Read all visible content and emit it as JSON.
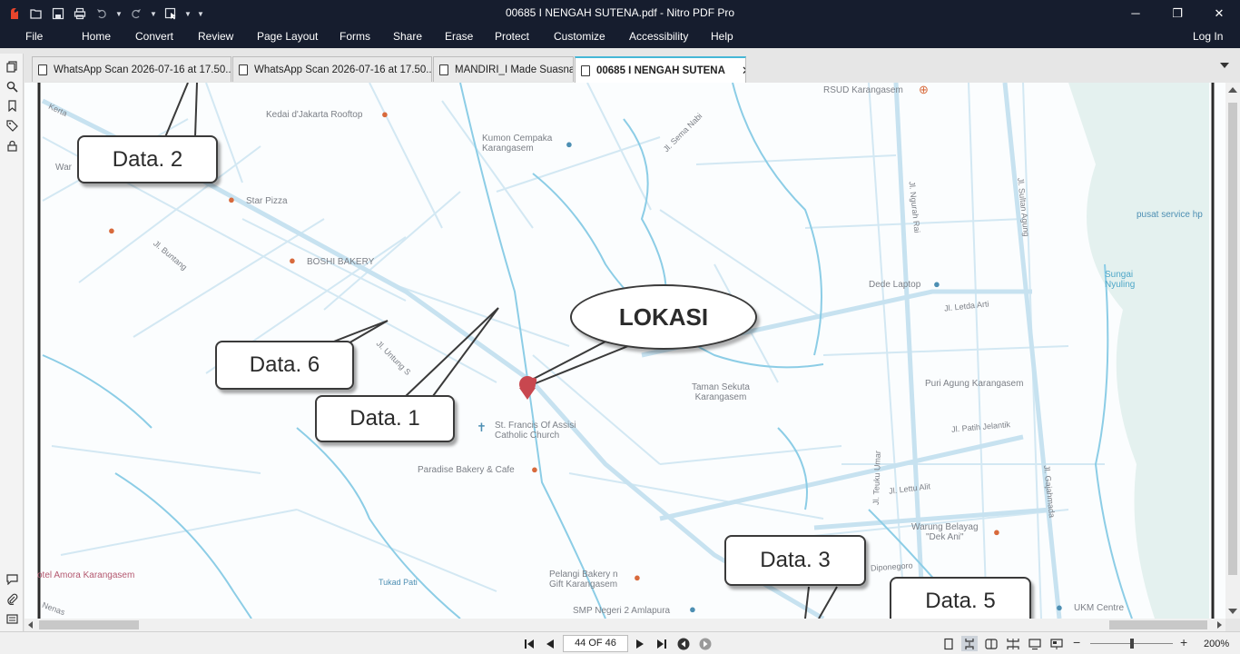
{
  "window": {
    "title": "00685 I NENGAH SUTENA.pdf - Nitro PDF Pro",
    "minimize": "─",
    "restore": "❐",
    "close": "✕"
  },
  "menu": [
    "File",
    "Home",
    "Convert",
    "Review",
    "Page Layout",
    "Forms",
    "Share",
    "Erase",
    "Protect",
    "Customize",
    "Accessibility",
    "Help"
  ],
  "login": "Log In",
  "tabs": [
    {
      "label": "WhatsApp Scan 2026-07-16 at 17.50..."
    },
    {
      "label": "WhatsApp Scan 2026-07-16 at 17.50..."
    },
    {
      "label": "MANDIRI_I Made Suasna"
    },
    {
      "label": "00685 I NENGAH SUTENA",
      "active": true,
      "close": "✕"
    }
  ],
  "map": {
    "callouts": {
      "data2": "Data. 2",
      "data6": "Data. 6",
      "data1": "Data. 1",
      "lokasi": "LOKASI",
      "data3": "Data. 3",
      "data5": "Data. 5"
    },
    "places": {
      "rsud": "RSUD Karangasem",
      "kedai": "Kedai d'Jakarta Rooftop",
      "kumon": "Kumon Cempaka\nKarangasem",
      "star_pizza": "Star Pizza",
      "boshi": "BOSHI BAKERY",
      "dede": "Dede Laptop",
      "taman": "Taman Sekuta\nKarangasem",
      "puri": "Puri Agung Karangasem",
      "stfrancis": "St. Francis Of Assisi\nCatholic Church",
      "paradise": "Paradise Bakery & Cafe",
      "warung": "Warung Belayag\n\"Dek Ani\"",
      "pelangi": "Pelangi Bakery n\nGift Karangasem",
      "smp": "SMP Negeri 2 Amlapura",
      "ukm": "UKM Centre",
      "amora": "otel Amora Karangasem",
      "pusat": "pusat service hp",
      "sungai": "Sungai\nNyuling",
      "war": "War"
    },
    "streets": {
      "kerta": "Kerta",
      "semanabi": "Jl. Sema Nabi",
      "ngurah_rai": "Jl. Ngurah Rai",
      "sultan_agung": "Jl. Sultan Agung",
      "letda_arti": "Jl. Letda Arti",
      "patih_jelantik": "Jl. Patih Jelantik",
      "teuku_umar": "Jl. Teuku Umar",
      "lettu_alit": "Jl. Lettu Alit",
      "gajahmada": "Jl. Gajahmada",
      "diponegoro": "Diponegoro",
      "tukad_pati": "Tukad Pati",
      "buntang": "Jl. Buntang",
      "untung": "Jl. Untung S",
      "nenas": "Nenas"
    }
  },
  "status": {
    "page_indicator": "44 OF 46",
    "zoom": "200%",
    "zoom_level_percent": 200,
    "zoom_minus": "−",
    "zoom_plus": "+"
  },
  "colors": {
    "titlebar": "#161d2e",
    "active_tab_accent": "#45b7d6",
    "river": "#8ccde6",
    "road": "#cfe6f2",
    "pin": "#c8474f"
  }
}
